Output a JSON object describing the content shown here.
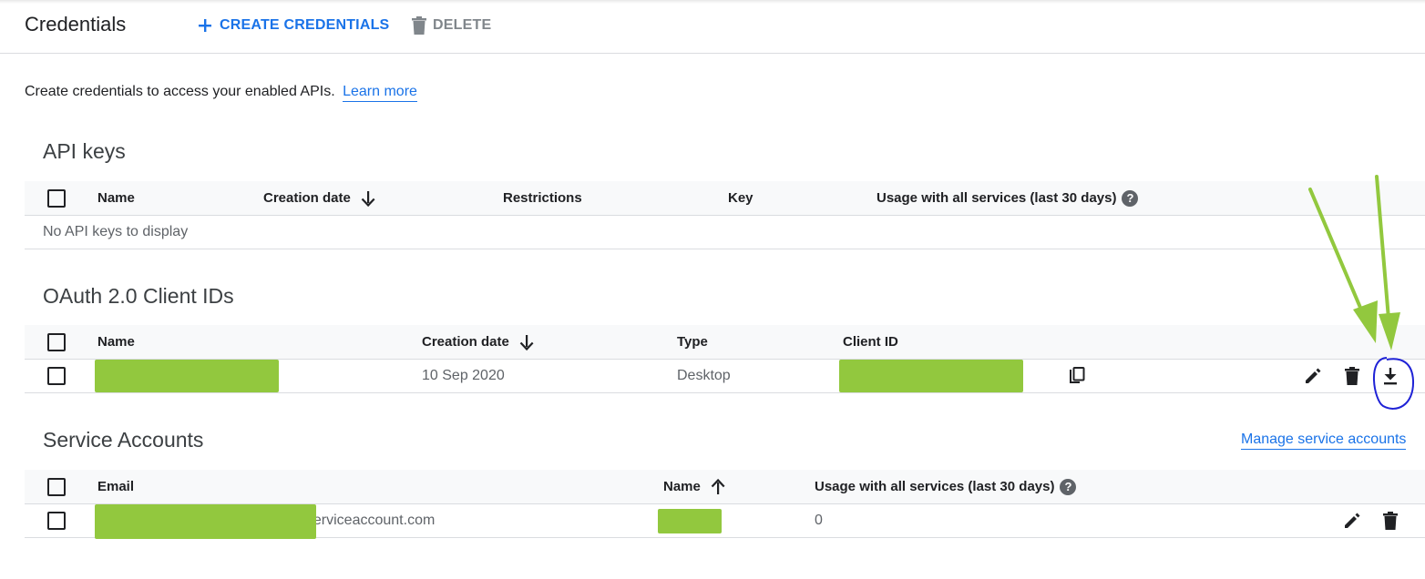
{
  "header": {
    "title": "Credentials",
    "create_label": "CREATE CREDENTIALS",
    "delete_label": "DELETE"
  },
  "intro": {
    "text": "Create credentials to access your enabled APIs.",
    "learn_more": "Learn more"
  },
  "api_keys": {
    "title": "API keys",
    "columns": {
      "name": "Name",
      "creation_date": "Creation date",
      "restrictions": "Restrictions",
      "key": "Key",
      "usage": "Usage with all services (last 30 days)"
    },
    "empty_text": "No API keys to display"
  },
  "oauth": {
    "title": "OAuth 2.0 Client IDs",
    "columns": {
      "name": "Name",
      "creation_date": "Creation date",
      "type": "Type",
      "client_id": "Client ID"
    },
    "rows": [
      {
        "creation_date": "10 Sep 2020",
        "type": "Desktop"
      }
    ]
  },
  "service_accounts": {
    "title": "Service Accounts",
    "manage_link": "Manage service accounts",
    "columns": {
      "email": "Email",
      "name": "Name",
      "usage": "Usage with all services (last 30 days)"
    },
    "rows": [
      {
        "email_suffix": "gserviceaccount.com",
        "usage": "0"
      }
    ]
  },
  "colors": {
    "accent": "#1a73e8",
    "redaction": "#92c83e",
    "arrow": "#92c83e",
    "circle": "#1f22d6"
  },
  "icons": {
    "add": "plus-icon",
    "delete": "trash-icon",
    "sort_down": "arrow-down-icon",
    "sort_up": "arrow-up-icon",
    "help": "help-circle-icon",
    "copy": "copy-icon",
    "edit": "pencil-icon",
    "download": "download-icon"
  },
  "help_glyph": "?"
}
